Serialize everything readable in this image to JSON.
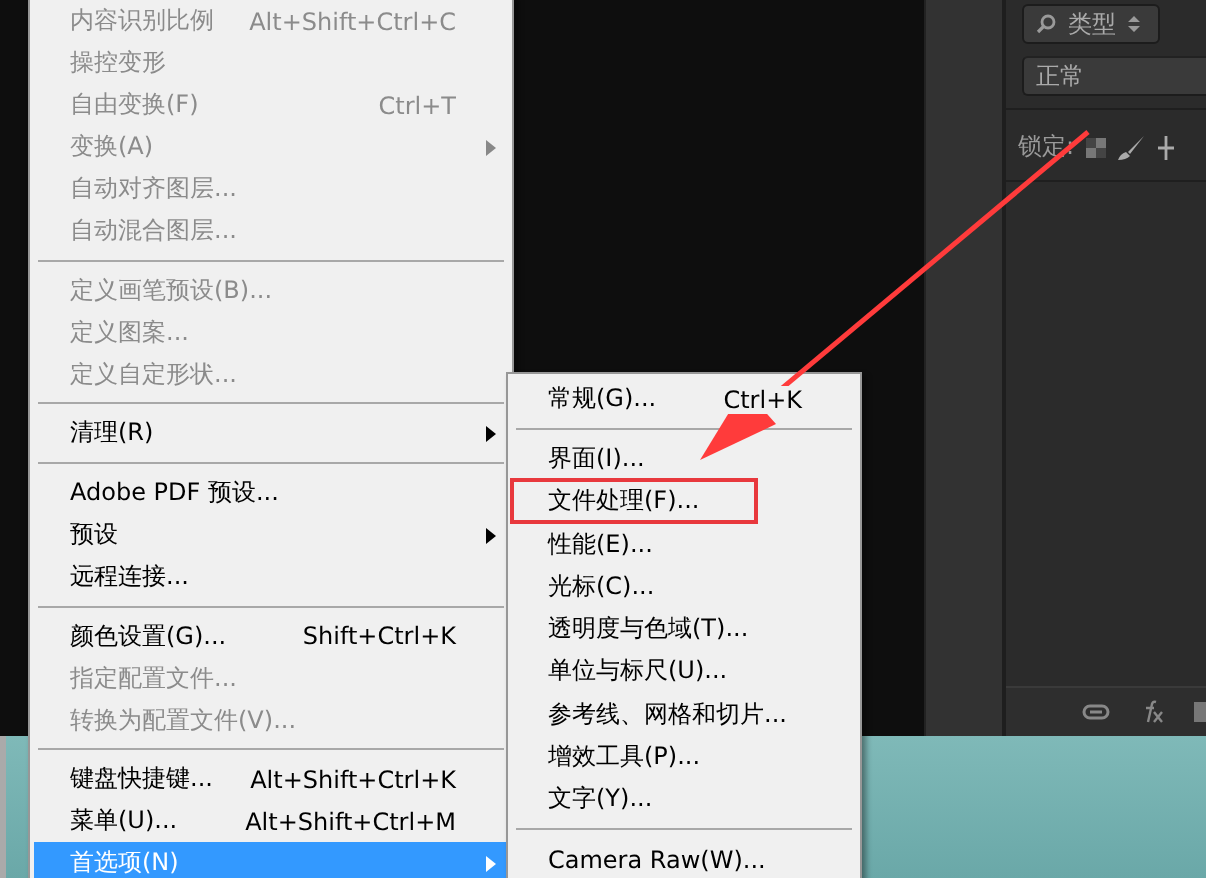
{
  "edit_menu": [
    {
      "kind": "item",
      "label": "内容识别比例",
      "shortcut": "Alt+Shift+Ctrl+C",
      "disabled": true,
      "submenu": false,
      "selected": false
    },
    {
      "kind": "item",
      "label": "操控变形",
      "disabled": true,
      "submenu": false,
      "selected": false
    },
    {
      "kind": "item",
      "label": "自由变换(F)",
      "shortcut": "Ctrl+T",
      "disabled": true,
      "submenu": false,
      "selected": false
    },
    {
      "kind": "item",
      "label": "变换(A)",
      "disabled": true,
      "submenu": true,
      "selected": false
    },
    {
      "kind": "item",
      "label": "自动对齐图层...",
      "disabled": true,
      "submenu": false,
      "selected": false
    },
    {
      "kind": "item",
      "label": "自动混合图层...",
      "disabled": true,
      "submenu": false,
      "selected": false
    },
    {
      "kind": "separator"
    },
    {
      "kind": "item",
      "label": "定义画笔预设(B)...",
      "disabled": true,
      "submenu": false,
      "selected": false
    },
    {
      "kind": "item",
      "label": "定义图案...",
      "disabled": true,
      "submenu": false,
      "selected": false
    },
    {
      "kind": "item",
      "label": "定义自定形状...",
      "disabled": true,
      "submenu": false,
      "selected": false
    },
    {
      "kind": "separator"
    },
    {
      "kind": "item",
      "label": "清理(R)",
      "disabled": false,
      "submenu": true,
      "selected": false
    },
    {
      "kind": "separator"
    },
    {
      "kind": "item",
      "label": "Adobe PDF 预设...",
      "disabled": false,
      "submenu": false,
      "selected": false
    },
    {
      "kind": "item",
      "label": "预设",
      "disabled": false,
      "submenu": true,
      "selected": false
    },
    {
      "kind": "item",
      "label": "远程连接...",
      "disabled": false,
      "submenu": false,
      "selected": false
    },
    {
      "kind": "separator"
    },
    {
      "kind": "item",
      "label": "颜色设置(G)...",
      "shortcut": "Shift+Ctrl+K",
      "disabled": false,
      "submenu": false,
      "selected": false
    },
    {
      "kind": "item",
      "label": "指定配置文件...",
      "disabled": true,
      "submenu": false,
      "selected": false
    },
    {
      "kind": "item",
      "label": "转换为配置文件(V)...",
      "disabled": true,
      "submenu": false,
      "selected": false
    },
    {
      "kind": "separator"
    },
    {
      "kind": "item",
      "label": "键盘快捷键...",
      "shortcut": "Alt+Shift+Ctrl+K",
      "disabled": false,
      "submenu": false,
      "selected": false
    },
    {
      "kind": "item",
      "label": "菜单(U)...",
      "shortcut": "Alt+Shift+Ctrl+M",
      "disabled": false,
      "submenu": false,
      "selected": false
    },
    {
      "kind": "item",
      "label": "首选项(N)",
      "disabled": false,
      "submenu": true,
      "selected": true
    }
  ],
  "preferences_submenu": [
    {
      "kind": "item",
      "label": "常规(G)...",
      "shortcut": "Ctrl+K",
      "highlighted": false
    },
    {
      "kind": "separator"
    },
    {
      "kind": "item",
      "label": "界面(I)...",
      "highlighted": false
    },
    {
      "kind": "item",
      "label": "文件处理(F)...",
      "highlighted": true
    },
    {
      "kind": "item",
      "label": "性能(E)...",
      "highlighted": false
    },
    {
      "kind": "item",
      "label": "光标(C)...",
      "highlighted": false
    },
    {
      "kind": "item",
      "label": "透明度与色域(T)...",
      "highlighted": false
    },
    {
      "kind": "item",
      "label": "单位与标尺(U)...",
      "highlighted": false
    },
    {
      "kind": "item",
      "label": "参考线、网格和切片...",
      "highlighted": false
    },
    {
      "kind": "item",
      "label": "增效工具(P)...",
      "highlighted": false
    },
    {
      "kind": "item",
      "label": "文字(Y)...",
      "highlighted": false
    },
    {
      "kind": "separator"
    },
    {
      "kind": "item",
      "label": "Camera Raw(W)...",
      "highlighted": false
    }
  ],
  "layers_panel": {
    "filter": "类型",
    "blend_mode": "正常",
    "lock_label": "锁定:"
  }
}
